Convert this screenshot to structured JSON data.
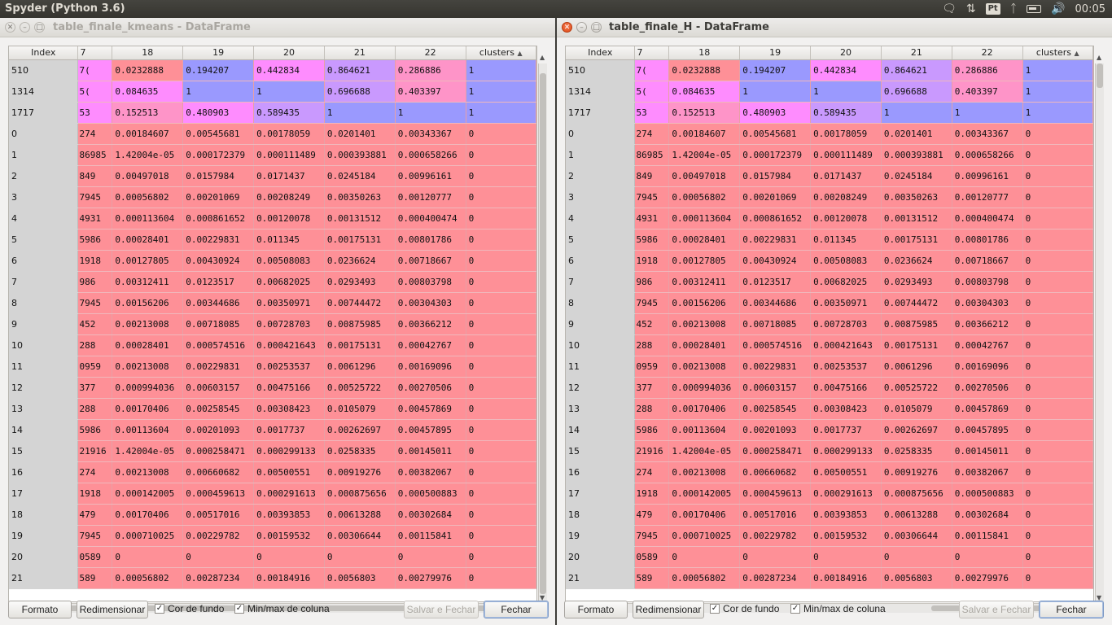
{
  "system": {
    "app_title": "Spyder (Python 3.6)",
    "keyboard_layout": "Pt",
    "clock": "00:05"
  },
  "columns": {
    "index": "Index",
    "col17_partial": "7",
    "c18": "18",
    "c19": "19",
    "c20": "20",
    "c21": "21",
    "c22": "22",
    "clusters": "clusters"
  },
  "colors": {
    "pink": "#fe8cfe",
    "blue": "#9a99fe",
    "violet": "#c999fe",
    "rose": "#fe94c8",
    "red": "#fe9097",
    "index_gray": "#d4d4d4"
  },
  "rows": [
    {
      "idx": "510",
      "c17": ")7",
      "c18": "0.0232888",
      "c19": "0.194207",
      "c20": "0.442834",
      "c21": "0.864621",
      "c22": "0.286886",
      "cl": "1"
    },
    {
      "idx": "1314",
      "c17": ")5",
      "c18": "0.084635",
      "c19": "1",
      "c20": "1",
      "c21": "0.696688",
      "c22": "0.403397",
      "cl": "1"
    },
    {
      "idx": "1717",
      "c17": "53",
      "c18": "0.152513",
      "c19": "0.480903",
      "c20": "0.589435",
      "c21": "1",
      "c22": "1",
      "cl": "1"
    },
    {
      "idx": "0",
      "c17": "274",
      "c18": "0.00184607",
      "c19": "0.00545681",
      "c20": "0.00178059",
      "c21": "0.0201401",
      "c22": "0.00343367",
      "cl": "0"
    },
    {
      "idx": "1",
      "c17": "86985",
      "c18": "1.42004e-05",
      "c19": "0.000172379",
      "c20": "0.000111489",
      "c21": "0.000393881",
      "c22": "0.000658266",
      "cl": "0"
    },
    {
      "idx": "2",
      "c17": "849",
      "c18": "0.00497018",
      "c19": "0.0157984",
      "c20": "0.0171437",
      "c21": "0.0245184",
      "c22": "0.00996161",
      "cl": "0"
    },
    {
      "idx": "3",
      "c17": "7945",
      "c18": "0.00056802",
      "c19": "0.00201069",
      "c20": "0.00208249",
      "c21": "0.00350263",
      "c22": "0.00120777",
      "cl": "0"
    },
    {
      "idx": "4",
      "c17": "4931",
      "c18": "0.000113604",
      "c19": "0.000861652",
      "c20": "0.00120078",
      "c21": "0.00131512",
      "c22": "0.000400474",
      "cl": "0"
    },
    {
      "idx": "5",
      "c17": "5986",
      "c18": "0.00028401",
      "c19": "0.00229831",
      "c20": "0.011345",
      "c21": "0.00175131",
      "c22": "0.00801786",
      "cl": "0"
    },
    {
      "idx": "6",
      "c17": "1918",
      "c18": "0.00127805",
      "c19": "0.00430924",
      "c20": "0.00508083",
      "c21": "0.0236624",
      "c22": "0.00718667",
      "cl": "0"
    },
    {
      "idx": "7",
      "c17": "986",
      "c18": "0.00312411",
      "c19": "0.0123517",
      "c20": "0.00682025",
      "c21": "0.0293493",
      "c22": "0.00803798",
      "cl": "0"
    },
    {
      "idx": "8",
      "c17": "7945",
      "c18": "0.00156206",
      "c19": "0.00344686",
      "c20": "0.00350971",
      "c21": "0.00744472",
      "c22": "0.00304303",
      "cl": "0"
    },
    {
      "idx": "9",
      "c17": "452",
      "c18": "0.00213008",
      "c19": "0.00718085",
      "c20": "0.00728703",
      "c21": "0.00875985",
      "c22": "0.00366212",
      "cl": "0"
    },
    {
      "idx": "10",
      "c17": "288",
      "c18": "0.00028401",
      "c19": "0.000574516",
      "c20": "0.000421643",
      "c21": "0.00175131",
      "c22": "0.00042767",
      "cl": "0"
    },
    {
      "idx": "11",
      "c17": "0959",
      "c18": "0.00213008",
      "c19": "0.00229831",
      "c20": "0.00253537",
      "c21": "0.0061296",
      "c22": "0.00169096",
      "cl": "0"
    },
    {
      "idx": "12",
      "c17": "377",
      "c18": "0.000994036",
      "c19": "0.00603157",
      "c20": "0.00475166",
      "c21": "0.00525722",
      "c22": "0.00270506",
      "cl": "0"
    },
    {
      "idx": "13",
      "c17": "288",
      "c18": "0.00170406",
      "c19": "0.00258545",
      "c20": "0.00308423",
      "c21": "0.0105079",
      "c22": "0.00457869",
      "cl": "0"
    },
    {
      "idx": "14",
      "c17": "5986",
      "c18": "0.00113604",
      "c19": "0.00201093",
      "c20": "0.0017737",
      "c21": "0.00262697",
      "c22": "0.00457895",
      "cl": "0"
    },
    {
      "idx": "15",
      "c17": "21916",
      "c18": "1.42004e-05",
      "c19": "0.000258471",
      "c20": "0.000299133",
      "c21": "0.0258335",
      "c22": "0.00145011",
      "cl": "0"
    },
    {
      "idx": "16",
      "c17": "274",
      "c18": "0.00213008",
      "c19": "0.00660682",
      "c20": "0.00500551",
      "c21": "0.00919276",
      "c22": "0.00382067",
      "cl": "0"
    },
    {
      "idx": "17",
      "c17": "1918",
      "c18": "0.000142005",
      "c19": "0.000459613",
      "c20": "0.000291613",
      "c21": "0.000875656",
      "c22": "0.000500883",
      "cl": "0"
    },
    {
      "idx": "18",
      "c17": "479",
      "c18": "0.00170406",
      "c19": "0.00517016",
      "c20": "0.00393853",
      "c21": "0.00613288",
      "c22": "0.00302684",
      "cl": "0"
    },
    {
      "idx": "19",
      "c17": "7945",
      "c18": "0.000710025",
      "c19": "0.00229782",
      "c20": "0.00159532",
      "c21": "0.00306644",
      "c22": "0.00115841",
      "cl": "0"
    },
    {
      "idx": "20",
      "c17": "0589",
      "c18": "0",
      "c19": "0",
      "c20": "0",
      "c21": "0",
      "c22": "0",
      "cl": "0"
    },
    {
      "idx": "21",
      "c17": "589",
      "c18": "0.00056802",
      "c19": "0.00287234",
      "c20": "0.00184916",
      "c21": "0.0056803",
      "c22": "0.00279976",
      "cl": "0"
    }
  ],
  "row_colors": [
    [
      "pink",
      "red",
      "blue",
      "pink",
      "violet",
      "rose",
      "blue"
    ],
    [
      "pink",
      "pink",
      "blue",
      "blue",
      "violet",
      "rose",
      "blue"
    ],
    [
      "pink",
      "rose",
      "pink",
      "violet",
      "blue",
      "blue",
      "blue"
    ]
  ],
  "windows": [
    {
      "id": "left",
      "title": "table_finale_kmeans - DataFrame",
      "active": false
    },
    {
      "id": "right",
      "title": "table_finale_H - DataFrame",
      "active": true
    }
  ],
  "toolbar": {
    "format_label": "Formato",
    "resize_label": "Redimensionar",
    "bg_color_label": "Cor de fundo",
    "bg_color_checked": true,
    "minmax_label": "Min/max de coluna",
    "minmax_checked": true,
    "save_close_label": "Salvar e Fechar",
    "close_label": "Fechar"
  }
}
